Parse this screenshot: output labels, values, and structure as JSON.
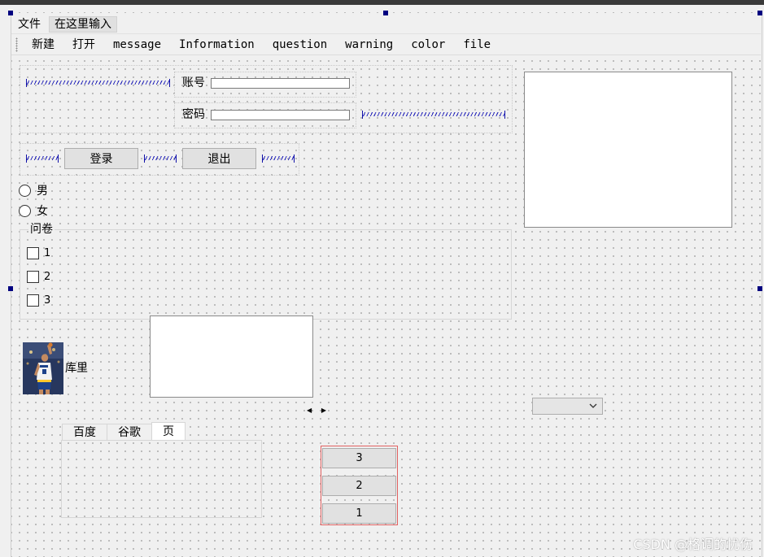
{
  "colors": {
    "spacer_blue": "#2020b8",
    "selection_handle": "#000080",
    "red_frame": "#e06060",
    "window_bg": "#f0f0f0"
  },
  "menubar": {
    "items": [
      "文件"
    ],
    "type_here": "在这里输入"
  },
  "toolbar": {
    "items": [
      "新建",
      "打开",
      "message",
      "Information",
      "question",
      "warning",
      "color",
      "file"
    ]
  },
  "login": {
    "account_label": "账号",
    "password_label": "密码",
    "account_value": "",
    "password_value": "",
    "login_button": "登录",
    "exit_button": "退出"
  },
  "gender": {
    "options": [
      "男",
      "女"
    ]
  },
  "survey": {
    "title": "问卷",
    "options": [
      "1",
      "2",
      "3"
    ]
  },
  "player": {
    "name": "库里"
  },
  "tabs": {
    "items": [
      "百度",
      "谷歌",
      "页"
    ],
    "active_index": 2
  },
  "stack_buttons": [
    "3",
    "2",
    "1"
  ],
  "watermark": "CSDN @格调的忧伤"
}
